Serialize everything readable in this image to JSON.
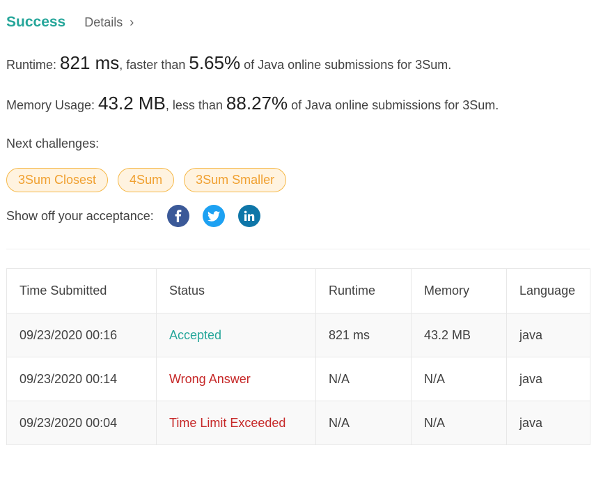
{
  "header": {
    "status": "Success",
    "details_label": "Details",
    "details_chevron": "›"
  },
  "runtime": {
    "prefix": "Runtime: ",
    "value": "821 ms",
    "mid": ", faster than ",
    "percent": "5.65%",
    "suffix": " of Java online submissions for 3Sum."
  },
  "memory": {
    "prefix": "Memory Usage: ",
    "value": "43.2 MB",
    "mid": ", less than ",
    "percent": "88.27%",
    "suffix": " of Java online submissions for 3Sum."
  },
  "next": {
    "label": "Next challenges:",
    "chips": [
      "3Sum Closest",
      "4Sum",
      "3Sum Smaller"
    ]
  },
  "share": {
    "label": "Show off your acceptance:",
    "icons": [
      "facebook-icon",
      "twitter-icon",
      "linkedin-icon"
    ]
  },
  "colors": {
    "accent_green": "#26a69a",
    "error_red": "#c62828",
    "chip_border": "#f5b94a",
    "chip_bg": "#fff3e0",
    "facebook": "#3b5998",
    "twitter": "#1da1f2",
    "linkedin": "#0e76a8"
  },
  "table": {
    "headers": [
      "Time Submitted",
      "Status",
      "Runtime",
      "Memory",
      "Language"
    ],
    "rows": [
      {
        "time": "09/23/2020 00:16",
        "status": "Accepted",
        "runtime": "821 ms",
        "memory": "43.2 MB",
        "language": "java"
      },
      {
        "time": "09/23/2020 00:14",
        "status": "Wrong Answer",
        "runtime": "N/A",
        "memory": "N/A",
        "language": "java"
      },
      {
        "time": "09/23/2020 00:04",
        "status": "Time Limit Exceeded",
        "runtime": "N/A",
        "memory": "N/A",
        "language": "java"
      }
    ]
  }
}
